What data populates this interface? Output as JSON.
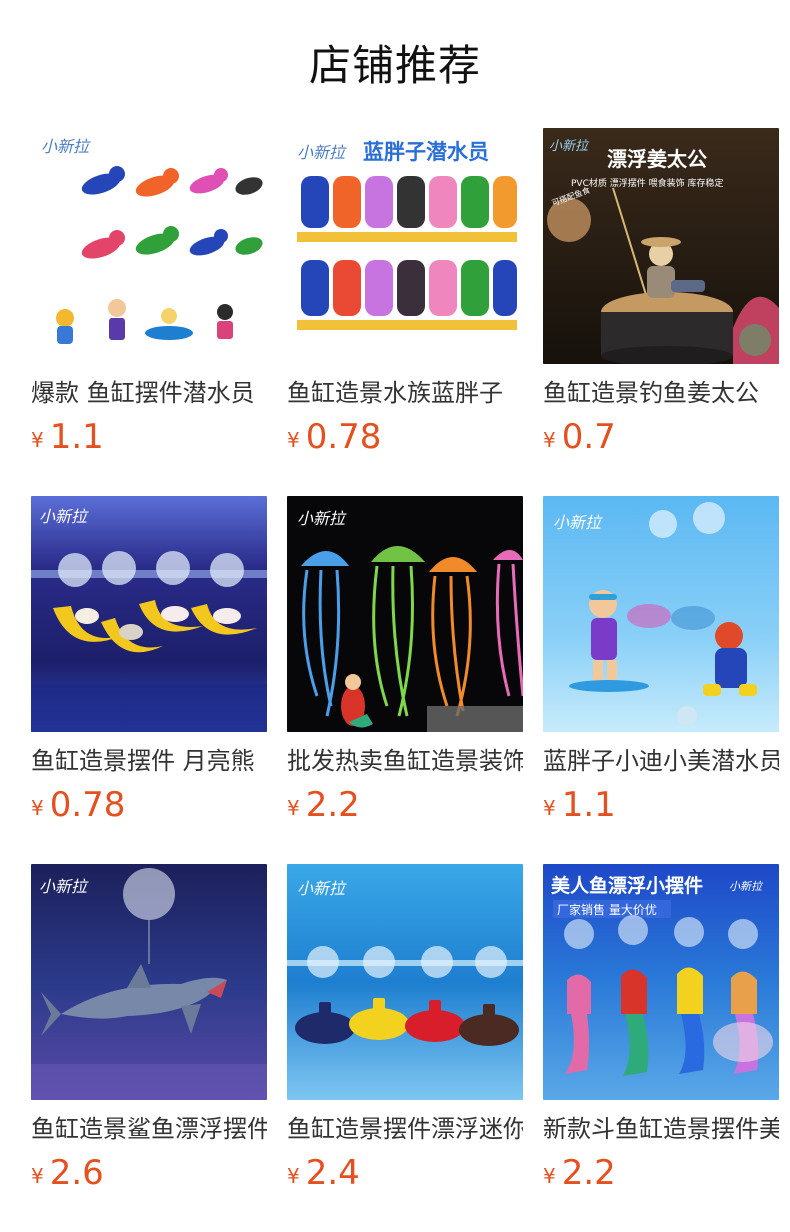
{
  "page": {
    "title": "店铺推荐"
  },
  "products": [
    {
      "name": "爆款 鱼缸摆件潜水员",
      "currency": "¥",
      "price": "1.1",
      "image": {
        "type": "divers-colorful",
        "logo": "小新拉"
      }
    },
    {
      "name": "鱼缸造景水族蓝胖子",
      "currency": "¥",
      "price": "0.78",
      "image": {
        "type": "divers-grid",
        "logo": "小新拉",
        "banner": "蓝胖子潜水员"
      }
    },
    {
      "name": "鱼缸造景钓鱼姜太公",
      "currency": "¥",
      "price": "0.7",
      "image": {
        "type": "fisherman",
        "logo": "小新拉",
        "headline": "漂浮姜太公",
        "subline": "PVC材质 漂浮摆件 喂食装饰 库存稳定",
        "tag": "可搭配鱼食"
      }
    },
    {
      "name": "鱼缸造景摆件 月亮熊",
      "currency": "¥",
      "price": "0.78",
      "image": {
        "type": "moon-bears",
        "logo": "小新拉"
      }
    },
    {
      "name": "批发热卖鱼缸造景装饰",
      "currency": "¥",
      "price": "2.2",
      "image": {
        "type": "jellyfish",
        "logo": "小新拉"
      }
    },
    {
      "name": "蓝胖子小迪小美潜水员",
      "currency": "¥",
      "price": "1.1",
      "image": {
        "type": "surfers",
        "logo": "小新拉"
      }
    },
    {
      "name": "鱼缸造景鲨鱼漂浮摆件",
      "currency": "¥",
      "price": "2.6",
      "image": {
        "type": "shark",
        "logo": "小新拉"
      }
    },
    {
      "name": "鱼缸造景摆件漂浮迷你",
      "currency": "¥",
      "price": "2.4",
      "image": {
        "type": "submarines",
        "logo": "小新拉"
      }
    },
    {
      "name": "新款斗鱼缸造景摆件美人鱼",
      "currency": "¥",
      "price": "2.2",
      "image": {
        "type": "mermaids",
        "logo": "小新拉",
        "headline": "美人鱼漂浮小摆件",
        "subline": "厂家销售 量大价优"
      }
    }
  ],
  "colors": {
    "price": "#e4501f",
    "title": "#111111",
    "text": "#333333"
  }
}
